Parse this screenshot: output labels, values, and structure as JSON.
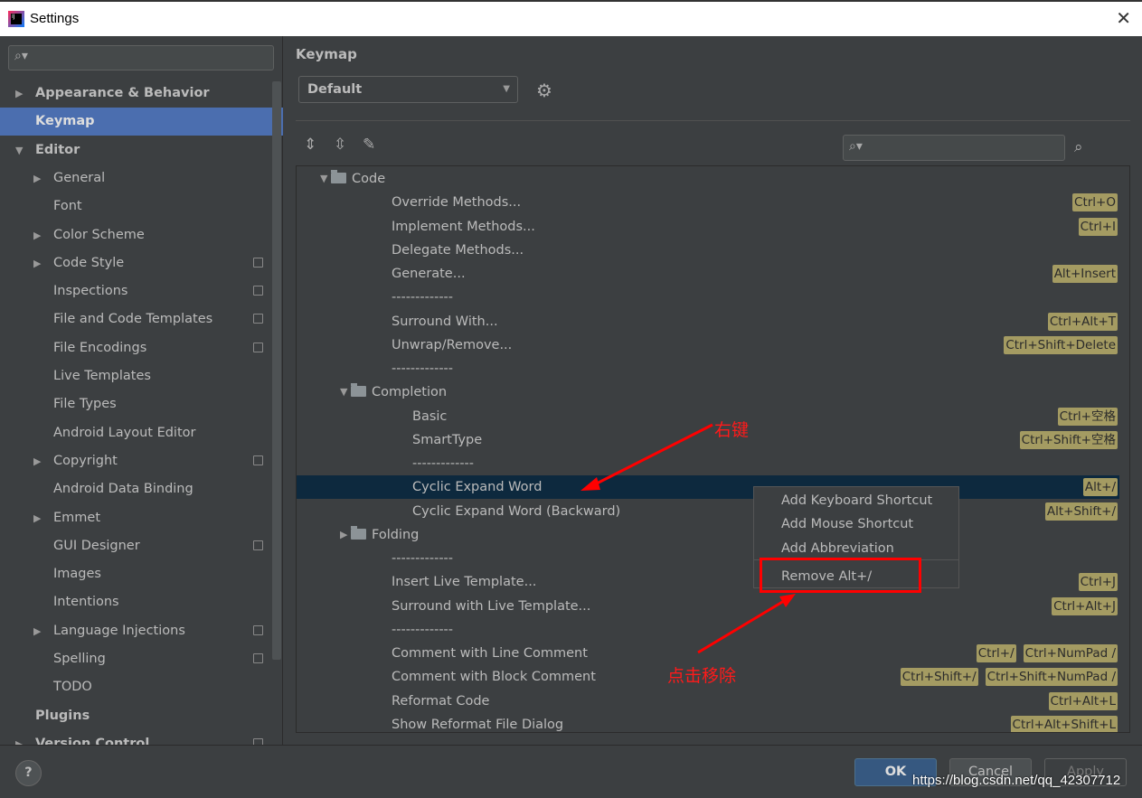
{
  "window": {
    "title": "Settings"
  },
  "sidebar": {
    "search_placeholder": "",
    "items": [
      {
        "label": "Appearance & Behavior",
        "level": 0,
        "arrow": "collapsed",
        "bold": true
      },
      {
        "label": "Keymap",
        "level": 0,
        "bold": true,
        "selected": true
      },
      {
        "label": "Editor",
        "level": 0,
        "arrow": "expanded",
        "bold": true
      },
      {
        "label": "General",
        "level": 1,
        "arrow": "collapsed"
      },
      {
        "label": "Font",
        "level": 1
      },
      {
        "label": "Color Scheme",
        "level": 1,
        "arrow": "collapsed"
      },
      {
        "label": "Code Style",
        "level": 1,
        "arrow": "collapsed",
        "project": true
      },
      {
        "label": "Inspections",
        "level": 1,
        "project": true
      },
      {
        "label": "File and Code Templates",
        "level": 1,
        "project": true
      },
      {
        "label": "File Encodings",
        "level": 1,
        "project": true
      },
      {
        "label": "Live Templates",
        "level": 1
      },
      {
        "label": "File Types",
        "level": 1
      },
      {
        "label": "Android Layout Editor",
        "level": 1
      },
      {
        "label": "Copyright",
        "level": 1,
        "arrow": "collapsed",
        "project": true
      },
      {
        "label": "Android Data Binding",
        "level": 1
      },
      {
        "label": "Emmet",
        "level": 1,
        "arrow": "collapsed"
      },
      {
        "label": "GUI Designer",
        "level": 1,
        "project": true
      },
      {
        "label": "Images",
        "level": 1
      },
      {
        "label": "Intentions",
        "level": 1
      },
      {
        "label": "Language Injections",
        "level": 1,
        "arrow": "collapsed",
        "project": true
      },
      {
        "label": "Spelling",
        "level": 1,
        "project": true
      },
      {
        "label": "TODO",
        "level": 1
      },
      {
        "label": "Plugins",
        "level": 0,
        "bold": true
      },
      {
        "label": "Version Control",
        "level": 0,
        "arrow": "collapsed",
        "bold": true,
        "project": true
      }
    ]
  },
  "main": {
    "heading": "Keymap",
    "keymap_select": "Default",
    "filter_placeholder": ""
  },
  "tree": [
    {
      "label": "Code",
      "level": 0,
      "folder": true,
      "arrow": "expanded",
      "keys": []
    },
    {
      "label": "Override Methods...",
      "level": 1,
      "keys": [
        "Ctrl+O"
      ]
    },
    {
      "label": "Implement Methods...",
      "level": 1,
      "keys": [
        "Ctrl+I"
      ]
    },
    {
      "label": "Delegate Methods...",
      "level": 1,
      "keys": []
    },
    {
      "label": "Generate...",
      "level": 1,
      "keys": [
        "Alt+Insert"
      ]
    },
    {
      "label": "-------------",
      "level": 1,
      "keys": []
    },
    {
      "label": "Surround With...",
      "level": 1,
      "keys": [
        "Ctrl+Alt+T"
      ]
    },
    {
      "label": "Unwrap/Remove...",
      "level": 1,
      "keys": [
        "Ctrl+Shift+Delete"
      ]
    },
    {
      "label": "-------------",
      "level": 1,
      "keys": []
    },
    {
      "label": "Completion",
      "level": 1,
      "folder": true,
      "arrow": "expanded",
      "keys": []
    },
    {
      "label": "Basic",
      "level": 2,
      "keys": [
        "Ctrl+空格"
      ]
    },
    {
      "label": "SmartType",
      "level": 2,
      "keys": [
        "Ctrl+Shift+空格"
      ]
    },
    {
      "label": "-------------",
      "level": 2,
      "keys": []
    },
    {
      "label": "Cyclic Expand Word",
      "level": 2,
      "keys": [
        "Alt+/"
      ],
      "selected": true
    },
    {
      "label": "Cyclic Expand Word (Backward)",
      "level": 2,
      "keys": [
        "Alt+Shift+/"
      ]
    },
    {
      "label": "Folding",
      "level": 1,
      "folder": true,
      "arrow": "collapsed",
      "keys": []
    },
    {
      "label": "-------------",
      "level": 1,
      "keys": []
    },
    {
      "label": "Insert Live Template...",
      "level": 1,
      "keys": [
        "Ctrl+J"
      ]
    },
    {
      "label": "Surround with Live Template...",
      "level": 1,
      "keys": [
        "Ctrl+Alt+J"
      ]
    },
    {
      "label": "-------------",
      "level": 1,
      "keys": []
    },
    {
      "label": "Comment with Line Comment",
      "level": 1,
      "keys": [
        "Ctrl+/",
        "Ctrl+NumPad /"
      ]
    },
    {
      "label": "Comment with Block Comment",
      "level": 1,
      "keys": [
        "Ctrl+Shift+/",
        "Ctrl+Shift+NumPad /"
      ]
    },
    {
      "label": "Reformat Code",
      "level": 1,
      "keys": [
        "Ctrl+Alt+L"
      ]
    },
    {
      "label": "Show Reformat File Dialog",
      "level": 1,
      "keys": [
        "Ctrl+Alt+Shift+L"
      ]
    }
  ],
  "context_menu": {
    "items": [
      "Add Keyboard Shortcut",
      "Add Mouse Shortcut",
      "Add Abbreviation",
      "Remove Alt+/"
    ]
  },
  "annotations": {
    "right_click": "右键",
    "click_remove": "点击移除",
    "color": "#ff0000"
  },
  "buttons": {
    "help": "?",
    "ok": "OK",
    "cancel": "Cancel",
    "apply": "Apply"
  },
  "watermark": "https://blog.csdn.net/qq_42307712",
  "colors": {
    "selection": "#4b6eaf",
    "tree_selection": "#0d293e",
    "shortcut_badge": "#a49b62"
  }
}
